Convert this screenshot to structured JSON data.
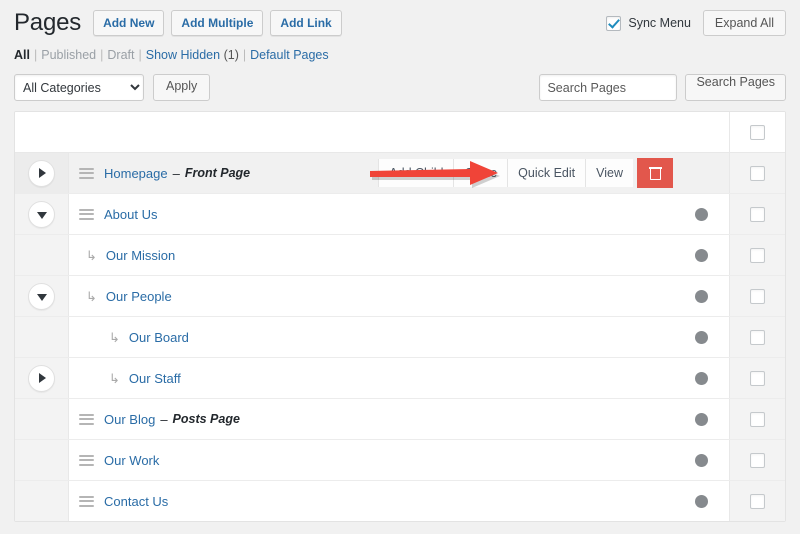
{
  "header": {
    "title": "Pages",
    "buttons": [
      {
        "label": "Add New",
        "name": "add-new-button"
      },
      {
        "label": "Add Multiple",
        "name": "add-multiple-button"
      },
      {
        "label": "Add Link",
        "name": "add-link-button"
      }
    ],
    "sync_menu_label": "Sync Menu",
    "sync_menu_checked": true,
    "expand_all_label": "Expand All"
  },
  "filters": {
    "all": "All",
    "published": "Published",
    "draft": "Draft",
    "show_hidden": "Show Hidden",
    "hidden_count": "(1)",
    "default_pages": "Default Pages",
    "separator": "|"
  },
  "tablenav": {
    "category_selected": "All Categories",
    "category_options": [
      "All Categories"
    ],
    "apply_label": "Apply",
    "search_placeholder": "Search Pages",
    "search_value": "",
    "search_button_label": "Search Pages"
  },
  "row_actions": {
    "add_child": "Add Child",
    "clone": "Clone",
    "quick_edit": "Quick Edit",
    "view": "View",
    "delete_icon": "trash-icon"
  },
  "annotation": {
    "arrow_color": "#f04438",
    "points_to": "Add Child"
  },
  "colors": {
    "link": "#2a6ca6",
    "danger": "#e2574c",
    "status_dot": "#868a8e",
    "page_bg": "#f1f1f1"
  },
  "rows": [
    {
      "title": "Homepage",
      "note": "Front Page",
      "dash": "–",
      "indent": 0,
      "toggle": "right",
      "handle": true,
      "highlighted": true,
      "show_actions": true,
      "show_status": false
    },
    {
      "title": "About Us",
      "note": "",
      "dash": "",
      "indent": 0,
      "toggle": "down",
      "handle": true,
      "highlighted": false,
      "show_actions": false,
      "show_status": true
    },
    {
      "title": "Our Mission",
      "note": "",
      "dash": "",
      "indent": 1,
      "toggle": "",
      "handle": false,
      "highlighted": false,
      "show_actions": false,
      "show_status": true
    },
    {
      "title": "Our People",
      "note": "",
      "dash": "",
      "indent": 1,
      "toggle": "down",
      "handle": false,
      "highlighted": false,
      "show_actions": false,
      "show_status": true
    },
    {
      "title": "Our Board",
      "note": "",
      "dash": "",
      "indent": 2,
      "toggle": "",
      "handle": false,
      "highlighted": false,
      "show_actions": false,
      "show_status": true
    },
    {
      "title": "Our Staff",
      "note": "",
      "dash": "",
      "indent": 2,
      "toggle": "right",
      "handle": false,
      "highlighted": false,
      "show_actions": false,
      "show_status": true
    },
    {
      "title": "Our Blog",
      "note": "Posts Page",
      "dash": "–",
      "indent": 0,
      "toggle": "",
      "handle": true,
      "highlighted": false,
      "show_actions": false,
      "show_status": true
    },
    {
      "title": "Our Work",
      "note": "",
      "dash": "",
      "indent": 0,
      "toggle": "",
      "handle": true,
      "highlighted": false,
      "show_actions": false,
      "show_status": true
    },
    {
      "title": "Contact Us",
      "note": "",
      "dash": "",
      "indent": 0,
      "toggle": "",
      "handle": true,
      "highlighted": false,
      "show_actions": false,
      "show_status": true
    }
  ]
}
